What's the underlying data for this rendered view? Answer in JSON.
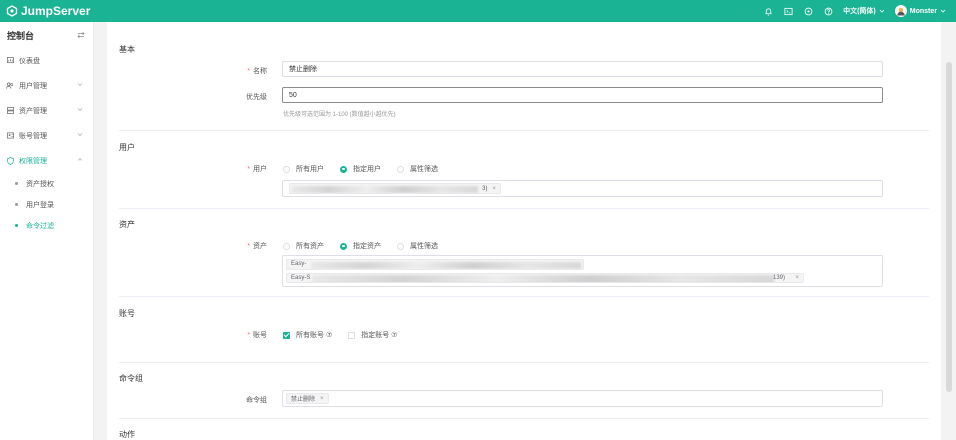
{
  "header": {
    "brand": "JumpServer",
    "language": "中文(简体)",
    "user": "Monster",
    "icons": [
      "bell-icon",
      "terminal-icon",
      "globe-icon",
      "help-icon"
    ]
  },
  "sidebar": {
    "title": "控制台",
    "items": [
      {
        "label": "仪表盘",
        "icon": "dashboard-icon"
      },
      {
        "label": "用户管理",
        "icon": "users-icon"
      },
      {
        "label": "资产管理",
        "icon": "assets-icon"
      },
      {
        "label": "账号管理",
        "icon": "accounts-icon"
      },
      {
        "label": "权限管理",
        "icon": "shield-icon"
      }
    ],
    "subitems": [
      "资产授权",
      "用户登录",
      "命令过滤"
    ]
  },
  "form": {
    "basic": {
      "title": "基本",
      "name_label": "名称",
      "name_value": "禁止删除",
      "priority_label": "优先级",
      "priority_value": "50",
      "priority_hint": "优先级可选范围为 1-100 (数值越小越优先)"
    },
    "users": {
      "title": "用户",
      "label": "用户",
      "options": [
        "所有用户",
        "指定用户",
        "属性筛选"
      ],
      "selected": "指定用户",
      "tag_suffix": "3)"
    },
    "assets": {
      "title": "资产",
      "label": "资产",
      "options": [
        "所有资产",
        "指定资产",
        "属性筛选"
      ],
      "selected": "指定资产",
      "tag1_prefix": "Easy-",
      "tag2_prefix": "Easy-S",
      "tag2_suffix": "139)"
    },
    "accounts": {
      "title": "账号",
      "label": "账号",
      "options": [
        "所有账号 ⑦",
        "指定账号 ⑦"
      ],
      "selected": "所有账号 ⑦"
    },
    "command_group": {
      "title": "命令组",
      "label": "命令组",
      "tag": "禁止删除"
    },
    "action": {
      "title": "动作"
    }
  },
  "colors": {
    "brand": "#1ab394",
    "required": "#f56c6c"
  }
}
